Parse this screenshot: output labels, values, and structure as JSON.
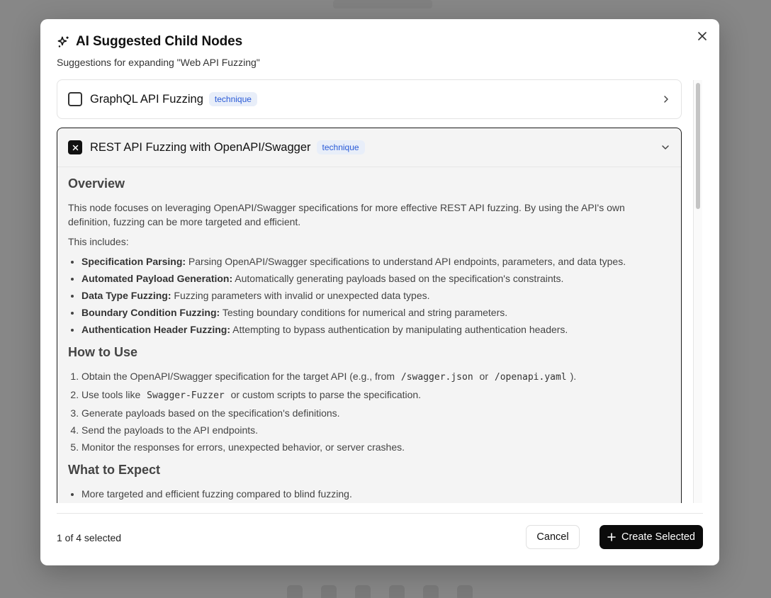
{
  "dialog": {
    "title": "AI Suggested Child Nodes",
    "subtitle": "Suggestions for expanding \"Web API Fuzzing\""
  },
  "items": [
    {
      "title": "GraphQL API Fuzzing",
      "badge": "technique",
      "checked": false,
      "expanded": false
    },
    {
      "title": "REST API Fuzzing with OpenAPI/Swagger",
      "badge": "technique",
      "checked": true,
      "expanded": true
    }
  ],
  "detail": {
    "overview_heading": "Overview",
    "overview_text": "This node focuses on leveraging OpenAPI/Swagger specifications for more effective REST API fuzzing. By using the API's own definition, fuzzing can be more targeted and efficient.",
    "includes_label": "This includes:",
    "includes": [
      {
        "term": "Specification Parsing:",
        "text": " Parsing OpenAPI/Swagger specifications to understand API endpoints, parameters, and data types."
      },
      {
        "term": "Automated Payload Generation:",
        "text": " Automatically generating payloads based on the specification's constraints."
      },
      {
        "term": "Data Type Fuzzing:",
        "text": " Fuzzing parameters with invalid or unexpected data types."
      },
      {
        "term": "Boundary Condition Fuzzing:",
        "text": " Testing boundary conditions for numerical and string parameters."
      },
      {
        "term": "Authentication Header Fuzzing:",
        "text": " Attempting to bypass authentication by manipulating authentication headers."
      }
    ],
    "howto_heading": "How to Use",
    "step1_pre": "Obtain the OpenAPI/Swagger specification for the target API (e.g., from ",
    "step1_code1": "/swagger.json",
    "step1_mid": " or ",
    "step1_code2": "/openapi.yaml",
    "step1_post": ").",
    "step2_pre": "Use tools like ",
    "step2_code": "Swagger-Fuzzer",
    "step2_post": " or custom scripts to parse the specification.",
    "step3": "Generate payloads based on the specification's definitions.",
    "step4": "Send the payloads to the API endpoints.",
    "step5": "Monitor the responses for errors, unexpected behavior, or server crashes.",
    "expect_heading": "What to Expect",
    "expect1": "More targeted and efficient fuzzing compared to blind fuzzing."
  },
  "footer": {
    "selected_text": "1 of 4 selected",
    "cancel_label": "Cancel",
    "create_label": "Create Selected"
  },
  "icons": {
    "title_icon": "sparkles-icon",
    "close_icon": "close-icon",
    "collapsed_chevron": "chevron-right-icon",
    "expanded_chevron": "chevron-down-icon",
    "create_icon": "plus-icon"
  },
  "colors": {
    "badge_text": "#2a5bd7",
    "badge_bg": "#e8eef9",
    "primary_button": "#0b0b0b"
  }
}
